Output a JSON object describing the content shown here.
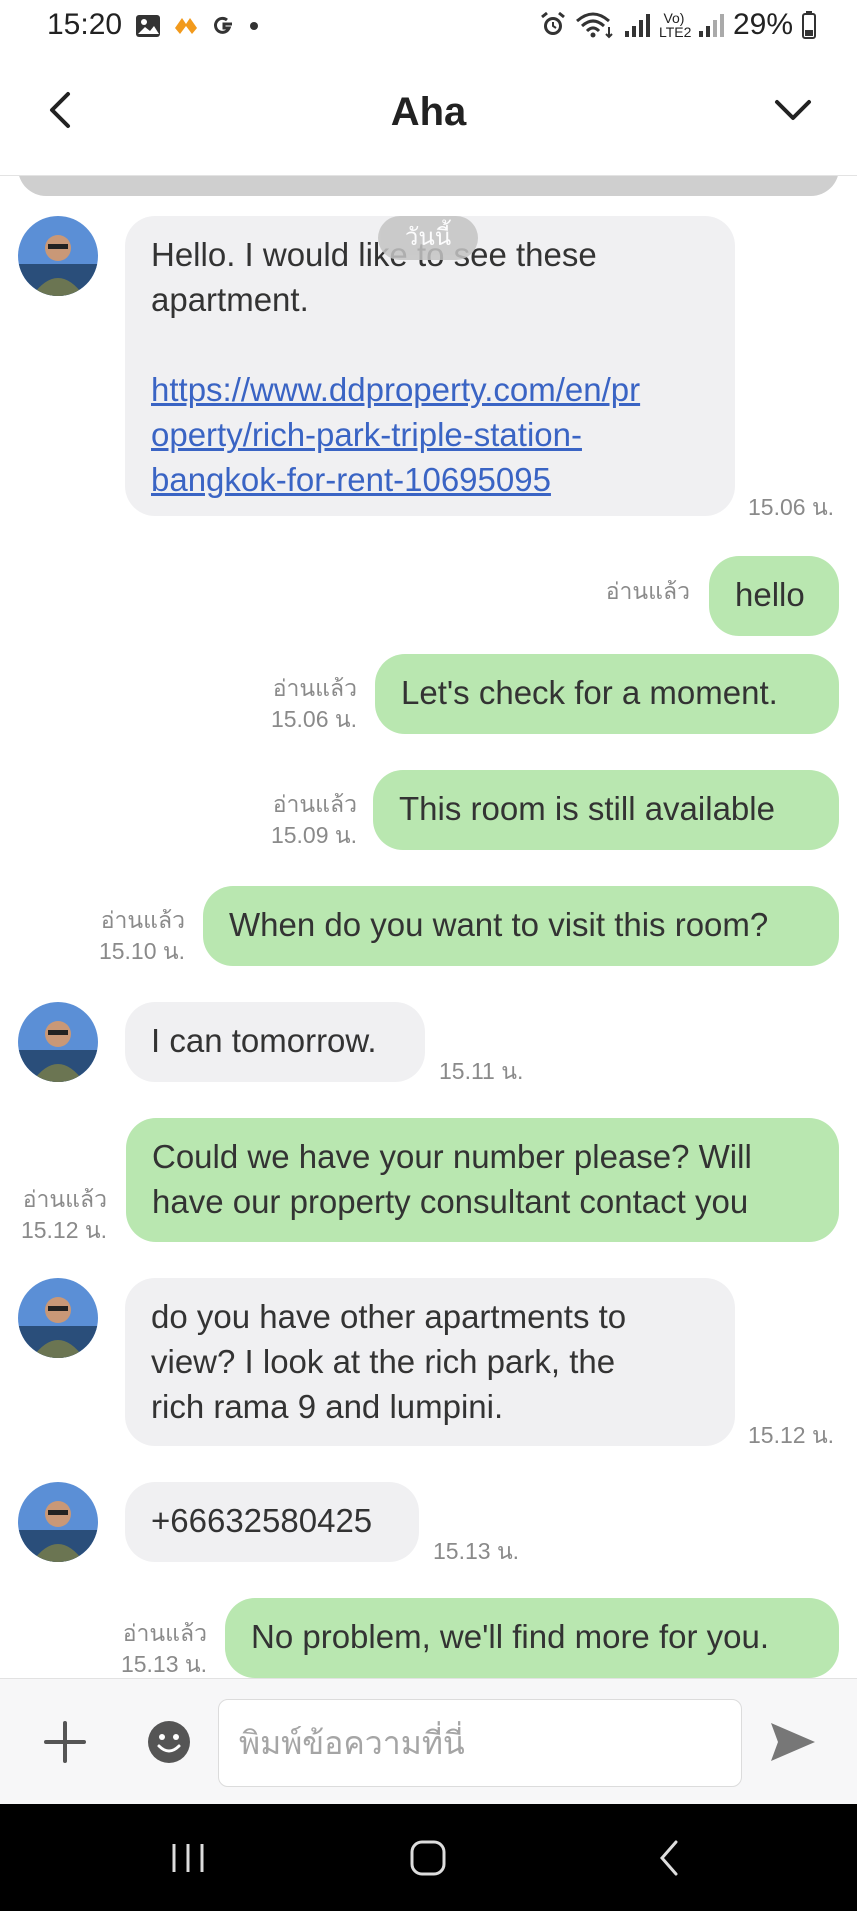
{
  "status_bar": {
    "time": "15:20",
    "battery": "29%",
    "network_label": "Vo) LTE2",
    "left_icons": [
      "image-icon",
      "tiktok-like-icon",
      "google-icon",
      "dot-icon"
    ],
    "right_icons": [
      "alarm-icon",
      "wifi-icon",
      "signal-icon",
      "signal-icon-2",
      "battery-icon"
    ]
  },
  "header": {
    "title": "Aha",
    "back_icon": "chevron-left-icon",
    "expand_icon": "chevron-down-icon"
  },
  "chat": {
    "date_separator": "วันนี้",
    "messages": [
      {
        "direction": "in",
        "text": "Hello. I would like to see these apartment.",
        "link": "https://www.ddproperty.com/en/property/rich-park-triple-station-bangkok-for-rent-10695095",
        "link_lines": [
          "https://www.ddproperty.com/en/pr",
          "operty/rich-park-triple-station-",
          "bangkok-for-rent-10695095"
        ],
        "time": "15.06 น."
      },
      {
        "direction": "out",
        "text": "hello",
        "read": "อ่านแล้ว",
        "time": ""
      },
      {
        "direction": "out",
        "text": "Let's check for a moment.",
        "read": "อ่านแล้ว",
        "time": "15.06 น."
      },
      {
        "direction": "out",
        "text": "This room is still available",
        "read": "อ่านแล้ว",
        "time": "15.09 น."
      },
      {
        "direction": "out",
        "text": "When do you want to visit this room?",
        "read": "อ่านแล้ว",
        "time": "15.10 น."
      },
      {
        "direction": "in",
        "text": "I can tomorrow.",
        "time": "15.11 น."
      },
      {
        "direction": "out",
        "lines": [
          "Could we have your number please? Will",
          "have our property consultant contact you"
        ],
        "read": "อ่านแล้ว",
        "time": "15.12 น."
      },
      {
        "direction": "in",
        "lines": [
          "do you have other apartments to",
          "view?  I look at the rich park, the",
          "rich rama 9 and lumpini."
        ],
        "time": "15.12 น."
      },
      {
        "direction": "in",
        "text": "+66632580425",
        "time": "15.13 น."
      },
      {
        "direction": "out",
        "text": "No problem, we'll find more for you.",
        "read": "อ่านแล้ว",
        "time": "15.13 น."
      }
    ]
  },
  "composer": {
    "placeholder": "พิมพ์ข้อความที่นี่",
    "plus_icon": "plus-icon",
    "emoji_icon": "emoji-icon",
    "send_icon": "send-icon"
  },
  "nav_bar": {
    "icons": [
      "recent-apps-icon",
      "home-icon",
      "back-icon"
    ]
  },
  "colors": {
    "outgoing_bubble": "#b9e7b0",
    "incoming_bubble": "#f0f0f2",
    "link": "#3a64c4",
    "meta_text": "#8a8a8a"
  }
}
